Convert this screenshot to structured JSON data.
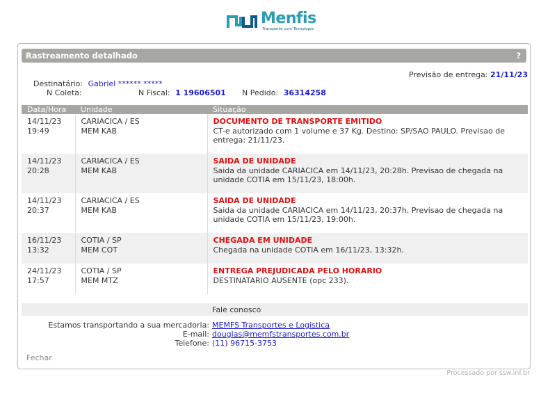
{
  "logo": {
    "word": "Menfis",
    "tagline": "Transporte com Tecnologia",
    "brand_color": "#2a9bb5"
  },
  "panel": {
    "title": "Rastreamento detalhado",
    "help": "?"
  },
  "delivery_forecast": {
    "label": "Previsão de entrega:",
    "value": "21/11/23"
  },
  "recipient": {
    "label": "Destinatário:",
    "value": "Gabriel ****** *****"
  },
  "collect": {
    "label": "N Coleta:",
    "value": ""
  },
  "invoice": {
    "label": "N Fiscal:",
    "value": "1 19606501"
  },
  "order": {
    "label": "N Pedido:",
    "value": "36314258"
  },
  "table": {
    "headers": [
      "Data/Hora",
      "Unidade",
      "Situação"
    ],
    "rows": [
      {
        "date": "14/11/23",
        "time": "19:49",
        "unit_city": "CARIACICA / ES",
        "unit_code": "MEM KAB",
        "status": "DOCUMENTO DE TRANSPORTE EMITIDO",
        "detail": "CT-e autorizado com 1 volume e 37 Kg. Destino: SP/SAO PAULO. Previsao de entrega: 21/11/23."
      },
      {
        "date": "14/11/23",
        "time": "20:28",
        "unit_city": "CARIACICA / ES",
        "unit_code": "MEM KAB",
        "status": "SAIDA DE UNIDADE",
        "detail": "Saida da unidade CARIACICA em 14/11/23, 20:28h. Previsao de chegada na unidade COTIA em 15/11/23, 18:00h."
      },
      {
        "date": "14/11/23",
        "time": "20:37",
        "unit_city": "CARIACICA / ES",
        "unit_code": "MEM KAB",
        "status": "SAIDA DE UNIDADE",
        "detail": "Saida da unidade CARIACICA em 14/11/23, 20:37h. Previsao de chegada na unidade COTIA em 15/11/23, 19:00h."
      },
      {
        "date": "16/11/23",
        "time": "13:32",
        "unit_city": "COTIA / SP",
        "unit_code": "MEM COT",
        "status": "CHEGADA EM UNIDADE",
        "detail": "Chegada na unidade COTIA em 16/11/23, 13:32h."
      },
      {
        "date": "24/11/23",
        "time": "17:57",
        "unit_city": "COTIA / SP",
        "unit_code": "MEM MTZ",
        "status": "ENTREGA PREJUDICADA PELO HORARIO",
        "detail": "DESTINATARIO AUSENTE (opc 233)."
      }
    ]
  },
  "contact": {
    "heading": "Fale conosco",
    "carrier_label": "Estamos transportando a sua mercadoria:",
    "carrier_value": "MEMFS Transportes e Logistica",
    "email_label": "E-mail:",
    "email_value": "douglas@memfstransportes.com.br",
    "phone_label": "Telefone:",
    "phone_value": "(11) 96715-3753"
  },
  "close_label": "Fechar",
  "footer": "Processado por ssw.inf.br",
  "colors": {
    "header_bg": "#a7a7a1",
    "status_red": "#e01010",
    "link_blue": "#1a1acc"
  }
}
